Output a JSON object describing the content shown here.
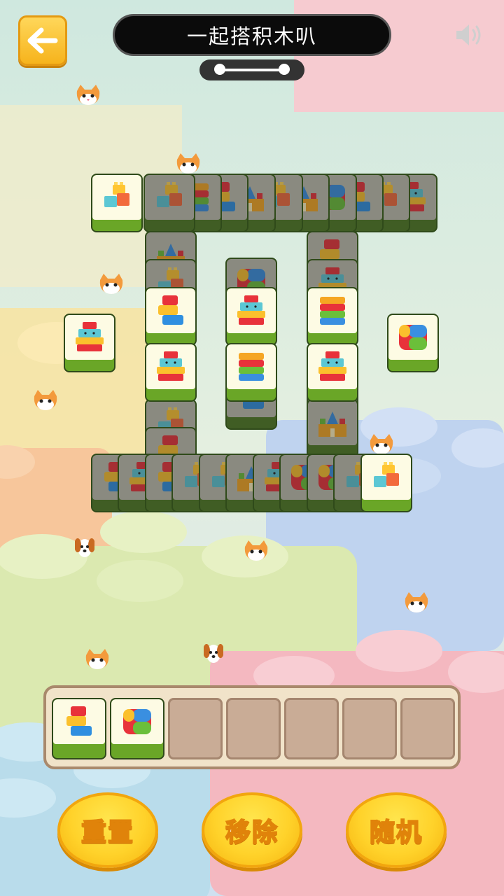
{
  "header": {
    "title": "一起搭积木叭",
    "back_icon": "back-arrow-icon",
    "sound_icon": "speaker-icon",
    "progress_fraction": 1.0
  },
  "board": {
    "tile_icons": [
      "stair-blocks-icon",
      "cube-stack-icon",
      "blocks-stack-icon",
      "wavy-blocks-icon",
      "toy-castle-icon",
      "face-blocks-icon"
    ]
  },
  "tray": {
    "capacity": 7,
    "items": [
      "cube-stack-icon",
      "wavy-blocks-icon"
    ]
  },
  "actions": {
    "reset": "重置",
    "remove": "移除",
    "shuffle": "随机"
  },
  "colors": {
    "accent_yellow": "#ffd22a",
    "tile_green": "#6aa627",
    "tray_bg": "#f1e3c9"
  }
}
